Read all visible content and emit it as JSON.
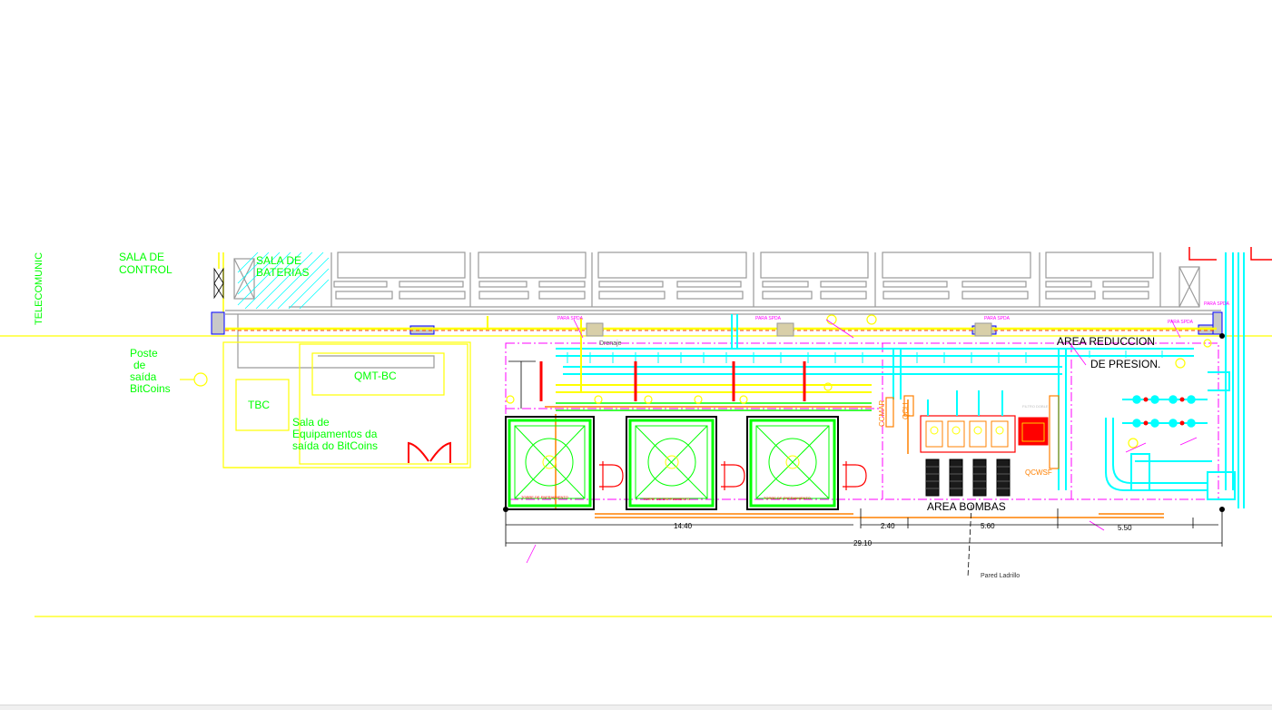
{
  "labels": {
    "telecom": "TELECOMUNIC",
    "sala_control_1": "SALA DE",
    "sala_control_2": "CONTROL",
    "sala_baterias_1": "SALA DE",
    "sala_baterias_2": "BATERIAS",
    "poste_1": "Poste",
    "poste_2": "de",
    "poste_3": "saída",
    "poste_4": "BitCoins",
    "qmt": "QMT-BC",
    "tbc": "TBC",
    "sala_equip_1": "Sala de",
    "sala_equip_2": "Equipamentos da",
    "sala_equip_3": "saída do BitCoins",
    "drenaje": "Drenaje",
    "area_reduccion_1": "AREA REDUCCION",
    "area_reduccion_2": "DE PRESION.",
    "area_bombas": "AREA BOMBAS",
    "pared": "Pared Ladrillo",
    "ccmar": "CCMAR",
    "qcl": "QCLI",
    "qcwsf": "QCWSF",
    "filtro": "FILTRO DOBLE",
    "para_spda": "PARA SPDA",
    "torre": "TORRE DE ENFRIAMIENTO"
  },
  "dimensions": {
    "d1": "14.40",
    "d2": "2.40",
    "d3": "5.60",
    "d4": "5.50",
    "total": "29.10"
  },
  "colors": {
    "background": "#ffffff",
    "wall": "#9a9a9a",
    "yellow": "#ffff00",
    "green": "#00ff00",
    "cyan": "#00ffff",
    "magenta": "#ff00ff",
    "red": "#ff0000",
    "orange": "#ff8000",
    "blue": "#0000ff",
    "black": "#000000"
  }
}
